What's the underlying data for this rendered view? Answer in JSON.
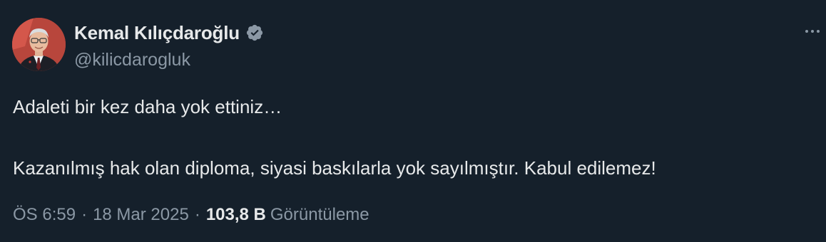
{
  "author": {
    "display_name": "Kemal Kılıçdaroğlu",
    "handle": "@kilicdarogluk",
    "verified_icon": "verified-badge-icon",
    "badge_color": "#8b98a5"
  },
  "tweet": {
    "line1": "Adaleti bir kez daha yok ettiniz…",
    "line2": "Kazanılmış hak olan diploma, siyasi baskılarla yok sayılmıştır. Kabul edilemez!"
  },
  "meta": {
    "time": "ÖS 6:59",
    "separator": "·",
    "date": "18 Mar 2025",
    "views_count": "103,8 B",
    "views_label": "Görüntüleme"
  },
  "colors": {
    "background": "#15202b",
    "text": "#e7e9ea",
    "secondary": "#8b98a5"
  }
}
